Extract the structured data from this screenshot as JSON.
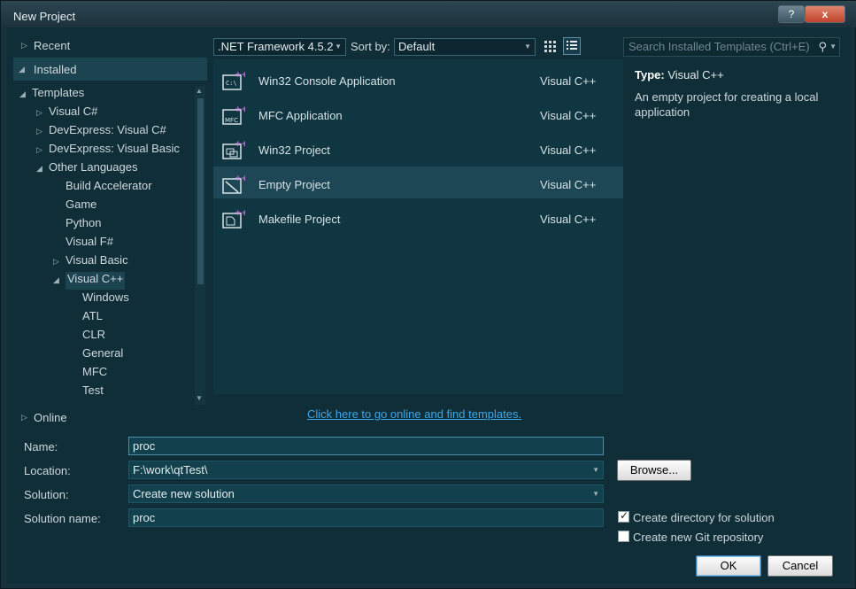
{
  "window": {
    "title": "New Project",
    "help_label": "?",
    "close_label": "x"
  },
  "nav": {
    "recent": "Recent",
    "installed": "Installed",
    "online": "Online",
    "tree": [
      {
        "label": "Templates",
        "level": 0,
        "expanded": true
      },
      {
        "label": "Visual C#",
        "level": 1,
        "expanded": false
      },
      {
        "label": "DevExpress: Visual C#",
        "level": 1,
        "expanded": false
      },
      {
        "label": "DevExpress: Visual Basic",
        "level": 1,
        "expanded": false
      },
      {
        "label": "Other Languages",
        "level": 1,
        "expanded": true
      },
      {
        "label": "Build Accelerator",
        "level": 2
      },
      {
        "label": "Game",
        "level": 2
      },
      {
        "label": "Python",
        "level": 2
      },
      {
        "label": "Visual F#",
        "level": 2
      },
      {
        "label": "Visual Basic",
        "level": 2,
        "expanded": false
      },
      {
        "label": "Visual C++",
        "level": 2,
        "expanded": true,
        "selected": true
      },
      {
        "label": "Windows",
        "level": 3
      },
      {
        "label": "ATL",
        "level": 3
      },
      {
        "label": "CLR",
        "level": 3
      },
      {
        "label": "General",
        "level": 3
      },
      {
        "label": "MFC",
        "level": 3
      },
      {
        "label": "Test",
        "level": 3
      }
    ]
  },
  "toolbar": {
    "framework": ".NET Framework 4.5.2",
    "sort_by_label": "Sort by:",
    "sort_value": "Default",
    "search_placeholder": "Search Installed Templates (Ctrl+E)"
  },
  "templates": [
    {
      "name": "Win32 Console Application",
      "lang": "Visual C++",
      "icon": "console-app-icon"
    },
    {
      "name": "MFC Application",
      "lang": "Visual C++",
      "icon": "mfc-app-icon"
    },
    {
      "name": "Win32 Project",
      "lang": "Visual C++",
      "icon": "win32-project-icon"
    },
    {
      "name": "Empty Project",
      "lang": "Visual C++",
      "icon": "empty-project-icon",
      "selected": true
    },
    {
      "name": "Makefile Project",
      "lang": "Visual C++",
      "icon": "makefile-project-icon"
    }
  ],
  "details": {
    "type_label": "Type:",
    "type_value": "Visual C++",
    "description": "An empty project for creating a local application"
  },
  "online_link": "Click here to go online and find templates.",
  "form": {
    "name_label": "Name:",
    "name_value": "proc",
    "location_label": "Location:",
    "location_value": "F:\\work\\qtTest\\",
    "solution_label": "Solution:",
    "solution_value": "Create new solution",
    "solution_name_label": "Solution name:",
    "solution_name_value": "proc",
    "browse_label": "Browse...",
    "create_dir_label": "Create directory for solution",
    "create_dir_checked": true,
    "git_label": "Create new Git repository",
    "git_checked": false,
    "ok_label": "OK",
    "cancel_label": "Cancel"
  }
}
